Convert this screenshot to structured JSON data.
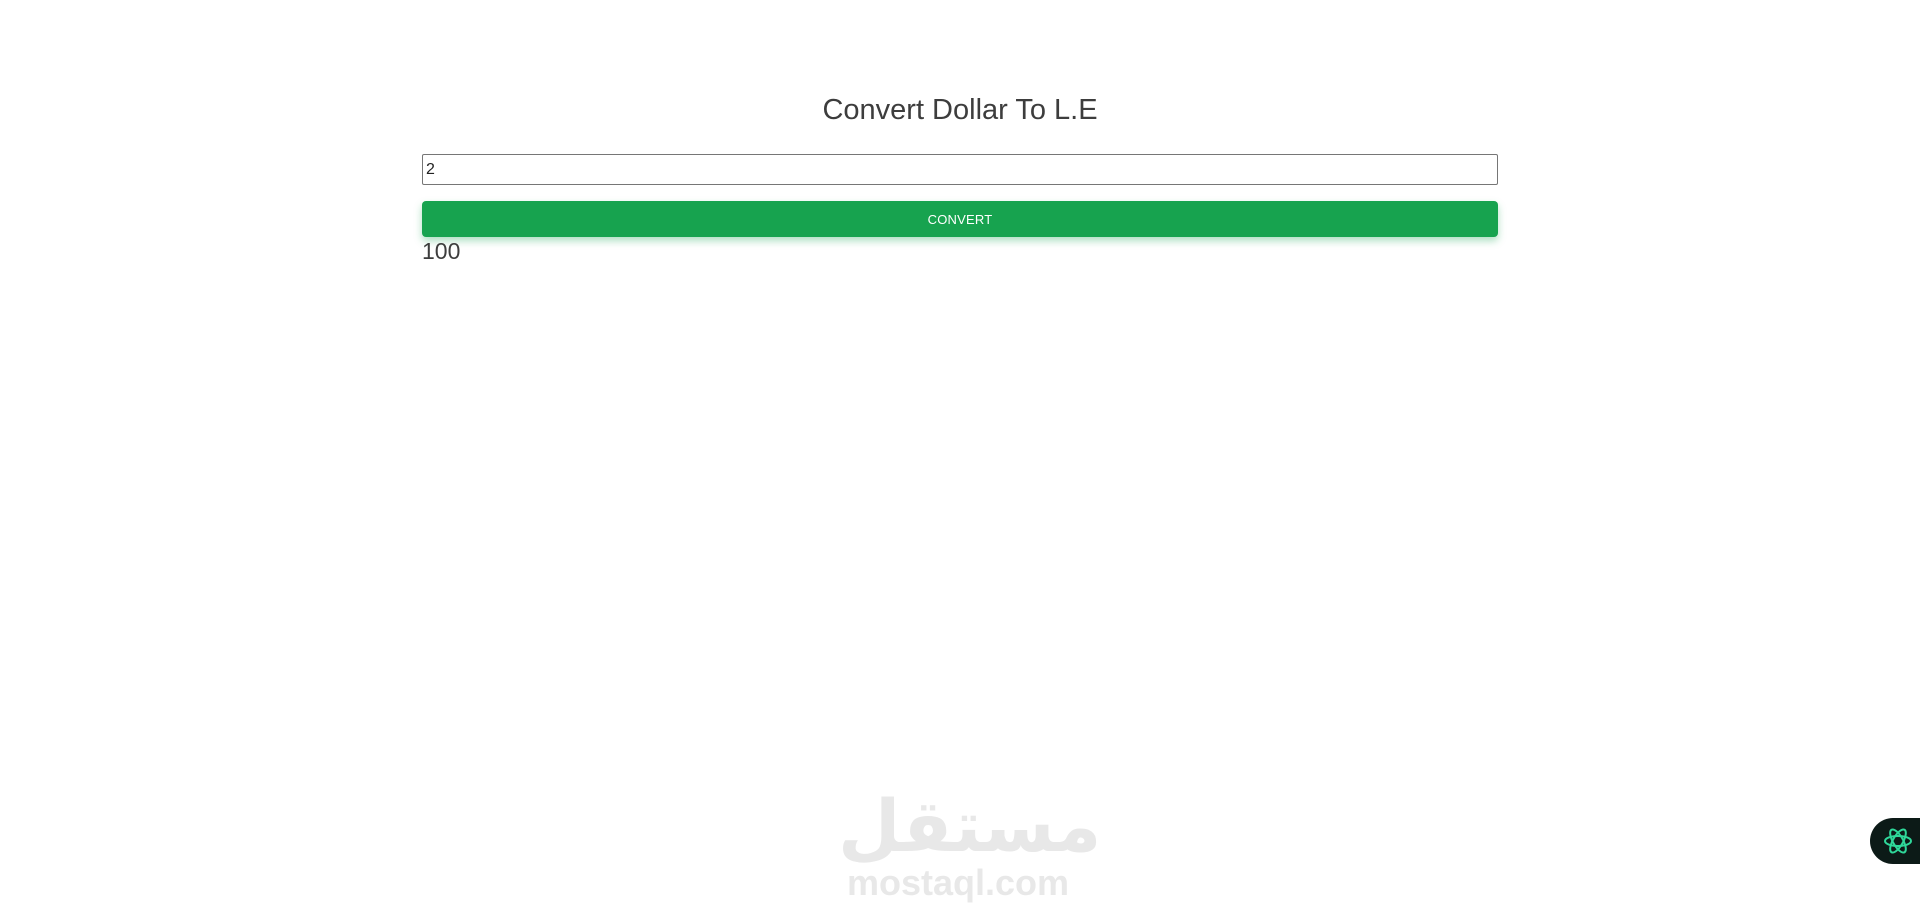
{
  "page": {
    "title": "Convert Dollar To L.E"
  },
  "form": {
    "amount_value": "2",
    "convert_label": "CONVERT"
  },
  "result": {
    "value": "100"
  },
  "watermark": {
    "arabic": "مستقل",
    "latin": "mostaql.com"
  },
  "assistant_badge": {
    "icon": "atom-icon"
  },
  "colors": {
    "accent": "#17a34f",
    "text": "#3d3d3d",
    "badge_bg": "#0c1a17",
    "badge_icon": "#2fd89a"
  }
}
